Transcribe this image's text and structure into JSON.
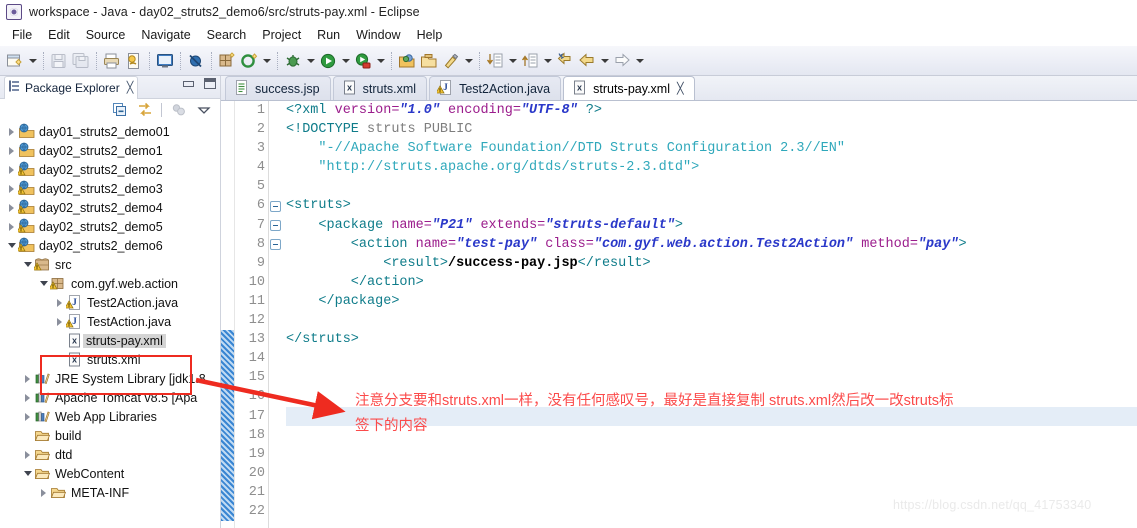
{
  "window": {
    "title": "workspace - Java - day02_struts2_demo6/src/struts-pay.xml - Eclipse",
    "app_icon": "eclipse-icon"
  },
  "menubar": {
    "items": [
      "File",
      "Edit",
      "Source",
      "Navigate",
      "Search",
      "Project",
      "Run",
      "Window",
      "Help"
    ]
  },
  "toolbar": {
    "groups": [
      {
        "items": [
          {
            "name": "new-wizard-icon",
            "arrow": true
          },
          {
            "sep": true
          },
          {
            "name": "save-icon",
            "arrow": false
          },
          {
            "name": "save-all-icon",
            "arrow": false
          },
          {
            "sep": true
          },
          {
            "name": "print-icon",
            "arrow": false
          },
          {
            "name": "export-icon",
            "arrow": false
          },
          {
            "sep": true
          },
          {
            "name": "open-console-icon",
            "arrow": false
          },
          {
            "sep": true
          },
          {
            "name": "skip-breakpoints-icon",
            "arrow": false
          },
          {
            "sep": true
          },
          {
            "name": "new-java-package-icon",
            "arrow": false
          },
          {
            "name": "new-java-class-icon",
            "arrow": true
          },
          {
            "sep": true
          },
          {
            "name": "debug-icon",
            "arrow": true
          },
          {
            "name": "run-icon",
            "arrow": true
          },
          {
            "name": "run-server-icon",
            "arrow": true
          },
          {
            "sep": true
          },
          {
            "name": "open-type-icon",
            "arrow": false
          },
          {
            "name": "open-task-icon",
            "arrow": false
          },
          {
            "name": "search-icon",
            "arrow": true
          },
          {
            "sep": true
          },
          {
            "name": "next-annotation-icon",
            "arrow": true
          },
          {
            "name": "previous-annotation-icon",
            "arrow": true
          },
          {
            "name": "last-edit-location-icon",
            "arrow": false
          },
          {
            "name": "back-icon",
            "arrow": true
          },
          {
            "name": "forward-icon",
            "arrow": true
          }
        ]
      }
    ]
  },
  "explorer": {
    "tab_title": "Package Explorer",
    "close_glyph": "╳",
    "tools": [
      "collapse-all-icon",
      "link-with-editor-icon",
      "focus-on-active-task-icon",
      "view-menu-icon"
    ],
    "tree": [
      {
        "label": "day01_struts2_demo01",
        "indent": 0,
        "twisty": "collapsed",
        "icon": "java-project-icon",
        "warn": false,
        "selected": false
      },
      {
        "label": "day02_struts2_demo1",
        "indent": 0,
        "twisty": "collapsed",
        "icon": "java-project-icon",
        "warn": false,
        "selected": false
      },
      {
        "label": "day02_struts2_demo2",
        "indent": 0,
        "twisty": "collapsed",
        "icon": "java-project-icon",
        "warn": true,
        "selected": false
      },
      {
        "label": "day02_struts2_demo3",
        "indent": 0,
        "twisty": "collapsed",
        "icon": "java-project-icon",
        "warn": true,
        "selected": false
      },
      {
        "label": "day02_struts2_demo4",
        "indent": 0,
        "twisty": "collapsed",
        "icon": "java-project-icon",
        "warn": true,
        "selected": false
      },
      {
        "label": "day02_struts2_demo5",
        "indent": 0,
        "twisty": "collapsed",
        "icon": "java-project-icon",
        "warn": true,
        "selected": false
      },
      {
        "label": "day02_struts2_demo6",
        "indent": 0,
        "twisty": "expanded",
        "icon": "java-project-icon",
        "warn": true,
        "selected": false
      },
      {
        "label": "src",
        "indent": 1,
        "twisty": "expanded",
        "icon": "source-folder-icon",
        "warn": true,
        "selected": false
      },
      {
        "label": "com.gyf.web.action",
        "indent": 2,
        "twisty": "expanded",
        "icon": "package-icon",
        "warn": true,
        "selected": false
      },
      {
        "label": "Test2Action.java",
        "indent": 3,
        "twisty": "collapsed",
        "icon": "java-file-icon",
        "warn": true,
        "selected": false
      },
      {
        "label": "TestAction.java",
        "indent": 3,
        "twisty": "collapsed",
        "icon": "java-file-icon",
        "warn": true,
        "selected": false
      },
      {
        "label": "struts-pay.xml",
        "indent": 3,
        "twisty": "none",
        "icon": "xml-file-icon",
        "warn": false,
        "selected": true
      },
      {
        "label": "struts.xml",
        "indent": 3,
        "twisty": "none",
        "icon": "xml-file-icon",
        "warn": false,
        "selected": false
      },
      {
        "label": "JRE System Library [jdk1.8",
        "indent": 1,
        "twisty": "collapsed",
        "icon": "library-icon",
        "warn": false,
        "selected": false
      },
      {
        "label": "Apache Tomcat v8.5 [Apa",
        "indent": 1,
        "twisty": "collapsed",
        "icon": "library-icon",
        "warn": false,
        "selected": false
      },
      {
        "label": "Web App Libraries",
        "indent": 1,
        "twisty": "collapsed",
        "icon": "library-icon",
        "warn": false,
        "selected": false
      },
      {
        "label": "build",
        "indent": 1,
        "twisty": "none",
        "icon": "folder-icon",
        "warn": false,
        "selected": false
      },
      {
        "label": "dtd",
        "indent": 1,
        "twisty": "collapsed",
        "icon": "folder-icon",
        "warn": false,
        "selected": false
      },
      {
        "label": "WebContent",
        "indent": 1,
        "twisty": "expanded",
        "icon": "folder-icon",
        "warn": false,
        "selected": false
      },
      {
        "label": "META-INF",
        "indent": 2,
        "twisty": "collapsed",
        "icon": "folder-icon",
        "warn": false,
        "selected": false
      }
    ]
  },
  "editor": {
    "tabs": [
      {
        "label": "success.jsp",
        "icon": "jsp-file-icon",
        "active": false,
        "closable": false
      },
      {
        "label": "struts.xml",
        "icon": "xml-file-icon",
        "active": false,
        "closable": false
      },
      {
        "label": "Test2Action.java",
        "icon": "java-file-icon",
        "active": false,
        "closable": false
      },
      {
        "label": "struts-pay.xml",
        "icon": "xml-file-icon",
        "active": true,
        "closable": true
      }
    ],
    "close_glyph": "╳",
    "highlight_line": 17,
    "marker_from_line": 13,
    "fold_lines": [
      6,
      7,
      8
    ],
    "lines": [
      {
        "n": 1,
        "segs": [
          {
            "t": "<?xml ",
            "c": "pi"
          },
          {
            "t": "version=",
            "c": "attr"
          },
          {
            "t": "\"1.0\"",
            "c": "val"
          },
          {
            "t": " encoding=",
            "c": "attr"
          },
          {
            "t": "\"UTF-8\"",
            "c": "val"
          },
          {
            "t": " ?>",
            "c": "pi"
          }
        ]
      },
      {
        "n": 2,
        "segs": [
          {
            "t": "<!DOCTYPE ",
            "c": "tag"
          },
          {
            "t": "struts PUBLIC",
            "c": "doct"
          }
        ]
      },
      {
        "n": 3,
        "segs": [
          {
            "t": "    \"-//Apache Software Foundation//DTD Struts Configuration 2.3//EN\"",
            "c": "dstr"
          }
        ]
      },
      {
        "n": 4,
        "segs": [
          {
            "t": "    \"http://struts.apache.org/dtds/struts-2.3.dtd\">",
            "c": "dstr"
          }
        ]
      },
      {
        "n": 5,
        "segs": []
      },
      {
        "n": 6,
        "segs": [
          {
            "t": "<struts>",
            "c": "tag"
          }
        ]
      },
      {
        "n": 7,
        "segs": [
          {
            "t": "    <package ",
            "c": "tag"
          },
          {
            "t": "name=",
            "c": "attr"
          },
          {
            "t": "\"P21\"",
            "c": "val"
          },
          {
            "t": " extends=",
            "c": "attr"
          },
          {
            "t": "\"struts-default\"",
            "c": "val"
          },
          {
            "t": ">",
            "c": "tag"
          }
        ]
      },
      {
        "n": 8,
        "segs": [
          {
            "t": "        <action ",
            "c": "tag"
          },
          {
            "t": "name=",
            "c": "attr"
          },
          {
            "t": "\"test-pay\"",
            "c": "val"
          },
          {
            "t": " class=",
            "c": "attr"
          },
          {
            "t": "\"com.gyf.web.action.Test2Action\"",
            "c": "val"
          },
          {
            "t": " method=",
            "c": "attr"
          },
          {
            "t": "\"pay\"",
            "c": "val"
          },
          {
            "t": ">",
            "c": "tag"
          }
        ]
      },
      {
        "n": 9,
        "segs": [
          {
            "t": "            <result>",
            "c": "tag"
          },
          {
            "t": "/success-pay.jsp",
            "c": "txt"
          },
          {
            "t": "</result>",
            "c": "tag"
          }
        ]
      },
      {
        "n": 10,
        "segs": [
          {
            "t": "        </action>",
            "c": "tag"
          }
        ]
      },
      {
        "n": 11,
        "segs": [
          {
            "t": "    </package>",
            "c": "tag"
          }
        ]
      },
      {
        "n": 12,
        "segs": []
      },
      {
        "n": 13,
        "segs": [
          {
            "t": "</struts>",
            "c": "tag"
          }
        ]
      },
      {
        "n": 14,
        "segs": []
      },
      {
        "n": 15,
        "segs": []
      },
      {
        "n": 16,
        "segs": []
      },
      {
        "n": 17,
        "segs": []
      },
      {
        "n": 18,
        "segs": []
      },
      {
        "n": 19,
        "segs": []
      },
      {
        "n": 20,
        "segs": []
      },
      {
        "n": 21,
        "segs": []
      },
      {
        "n": 22,
        "segs": []
      }
    ]
  },
  "annotations": {
    "note_line1": "注意分支要和struts.xml一样，没有任何感叹号，最好是直接复制 struts.xml然后改一改struts标",
    "note_line2": "签下的内容",
    "note_color": "#fb4b4b",
    "box_color": "#ee2b20",
    "arrow_color": "#ee2b20"
  },
  "watermark": {
    "text": "https://blog.csdn.net/qq_41753340"
  }
}
